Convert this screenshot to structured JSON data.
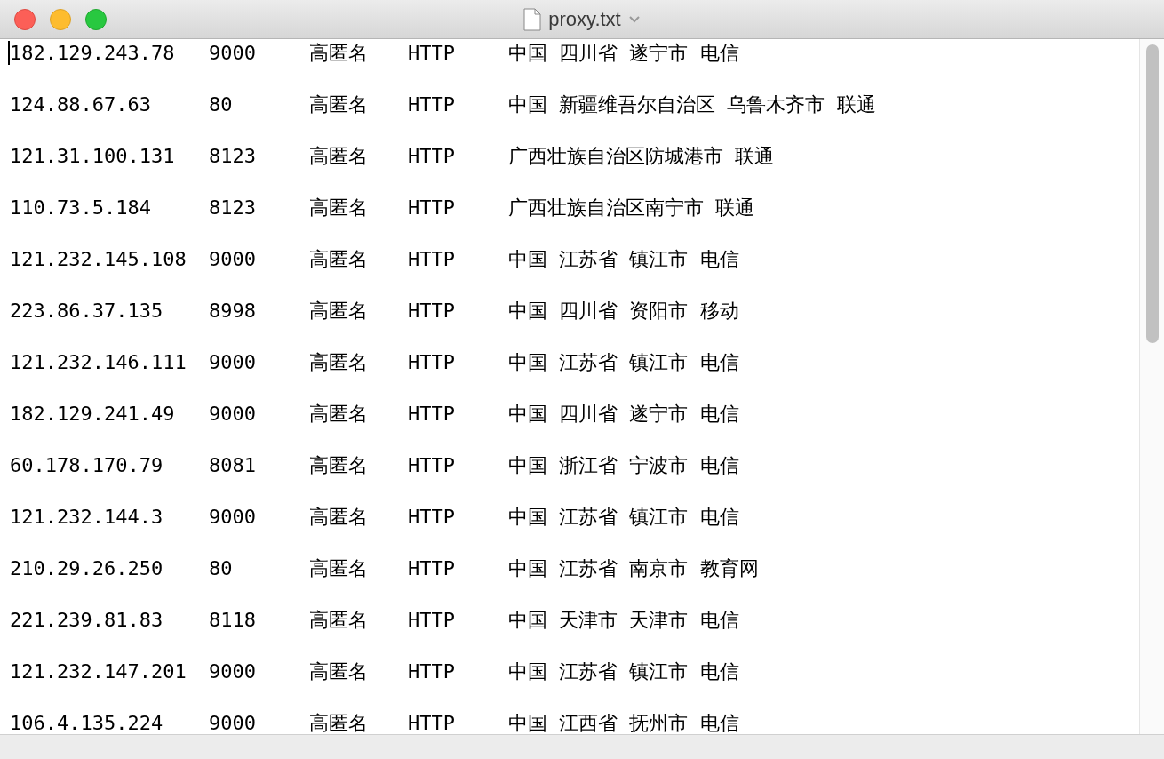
{
  "window": {
    "title": "proxy.txt"
  },
  "lines": [
    {
      "ip": "182.129.243.78",
      "port": "9000",
      "anonymity": "高匿名",
      "protocol": "HTTP",
      "location": "中国 四川省 遂宁市 电信"
    },
    {
      "ip": "124.88.67.63",
      "port": "80",
      "anonymity": "高匿名",
      "protocol": "HTTP",
      "location": "中国 新疆维吾尔自治区 乌鲁木齐市 联通"
    },
    {
      "ip": "121.31.100.131",
      "port": "8123",
      "anonymity": "高匿名",
      "protocol": "HTTP",
      "location": "广西壮族自治区防城港市 联通"
    },
    {
      "ip": "110.73.5.184",
      "port": "8123",
      "anonymity": "高匿名",
      "protocol": "HTTP",
      "location": "广西壮族自治区南宁市 联通"
    },
    {
      "ip": "121.232.145.108",
      "port": "9000",
      "anonymity": "高匿名",
      "protocol": "HTTP",
      "location": "中国 江苏省 镇江市 电信"
    },
    {
      "ip": "223.86.37.135",
      "port": "8998",
      "anonymity": "高匿名",
      "protocol": "HTTP",
      "location": "中国 四川省 资阳市 移动"
    },
    {
      "ip": "121.232.146.111",
      "port": "9000",
      "anonymity": "高匿名",
      "protocol": "HTTP",
      "location": "中国 江苏省 镇江市 电信"
    },
    {
      "ip": "182.129.241.49",
      "port": "9000",
      "anonymity": "高匿名",
      "protocol": "HTTP",
      "location": "中国 四川省 遂宁市 电信"
    },
    {
      "ip": "60.178.170.79",
      "port": "8081",
      "anonymity": "高匿名",
      "protocol": "HTTP",
      "location": "中国 浙江省 宁波市 电信"
    },
    {
      "ip": "121.232.144.3",
      "port": "9000",
      "anonymity": "高匿名",
      "protocol": "HTTP",
      "location": "中国 江苏省 镇江市 电信"
    },
    {
      "ip": "210.29.26.250",
      "port": "80",
      "anonymity": "高匿名",
      "protocol": "HTTP",
      "location": "中国 江苏省 南京市 教育网"
    },
    {
      "ip": "221.239.81.83",
      "port": "8118",
      "anonymity": "高匿名",
      "protocol": "HTTP",
      "location": "中国 天津市 天津市 电信"
    },
    {
      "ip": "121.232.147.201",
      "port": "9000",
      "anonymity": "高匿名",
      "protocol": "HTTP",
      "location": "中国 江苏省 镇江市 电信"
    },
    {
      "ip": "106.4.135.224",
      "port": "9000",
      "anonymity": "高匿名",
      "protocol": "HTTP",
      "location": "中国 江西省 抚州市 电信"
    }
  ]
}
